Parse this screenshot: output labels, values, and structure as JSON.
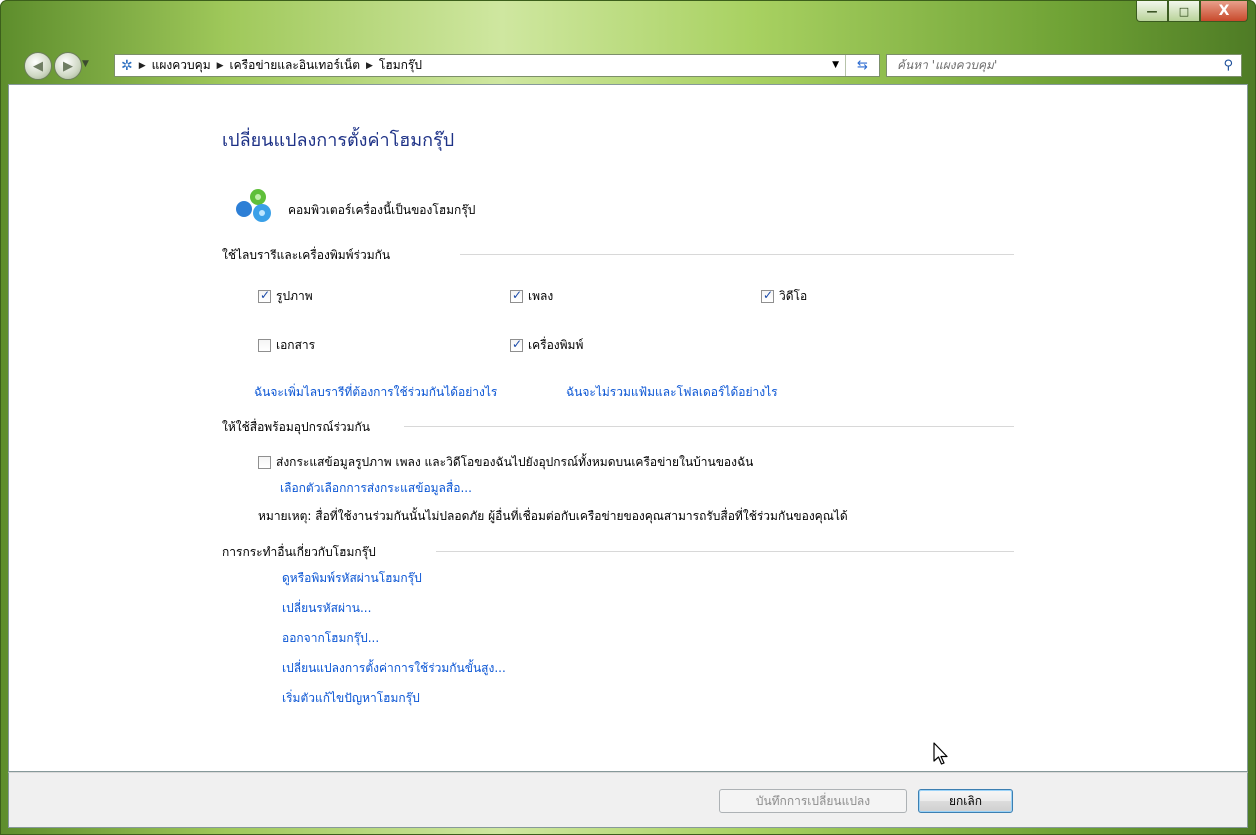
{
  "window": {
    "controls": {
      "minimize": "—",
      "maximize": "□",
      "close": "X"
    }
  },
  "address_bar": {
    "breadcrumbs": [
      "แผงควบคุม",
      "เครือข่ายและอินเทอร์เน็ต",
      "โฮมกรุ๊ป"
    ],
    "search_placeholder": "ค้นหา 'แผงควบคุม'"
  },
  "page": {
    "title": "เปลี่ยนแปลงการตั้งค่าโฮมกรุ๊ป",
    "membership_text": "คอมพิวเตอร์เครื่องนี้เป็นของโฮมกรุ๊ป"
  },
  "share_section": {
    "heading": "ใช้ไลบรารีและเครื่องพิมพ์ร่วมกัน",
    "items": [
      {
        "label": "รูปภาพ",
        "checked": true
      },
      {
        "label": "เพลง",
        "checked": true
      },
      {
        "label": "วิดีโอ",
        "checked": true
      },
      {
        "label": "เอกสาร",
        "checked": false
      },
      {
        "label": "เครื่องพิมพ์",
        "checked": true
      }
    ],
    "link_add_library": "ฉันจะเพิ่มไลบรารีที่ต้องการใช้ร่วมกันได้อย่างไร",
    "link_exclude": "ฉันจะไม่รวมแฟ้มและโฟลเดอร์ได้อย่างไร"
  },
  "media_section": {
    "heading": "ให้ใช้สื่อพร้อมอุปกรณ์ร่วมกัน",
    "stream_label": "ส่งกระแสข้อมูลรูปภาพ เพลง และวิดีโอของฉันไปยังอุปกรณ์ทั้งหมดบนเครือข่ายในบ้านของฉัน",
    "stream_checked": false,
    "stream_options_link": "เลือกตัวเลือกการส่งกระแสข้อมูลสื่อ...",
    "note": "หมายเหตุ: สื่อที่ใช้งานร่วมกันนั้นไม่ปลอดภัย ผู้อื่นที่เชื่อมต่อกับเครือข่ายของคุณสามารถรับสื่อที่ใช้ร่วมกันของคุณได้"
  },
  "actions_section": {
    "heading": "การกระทำอื่นเกี่ยวกับโฮมกรุ๊ป",
    "links": [
      "ดูหรือพิมพ์รหัสผ่านโฮมกรุ๊ป",
      "เปลี่ยนรหัสผ่าน...",
      "ออกจากโฮมกรุ๊ป...",
      "เปลี่ยนแปลงการตั้งค่าการใช้ร่วมกันขั้นสูง...",
      "เริ่มตัวแก้ไขปัญหาโฮมกรุ๊ป"
    ]
  },
  "footer": {
    "save_button": "บันทึกการเปลี่ยนแปลง",
    "cancel_button": "ยกเลิก"
  }
}
